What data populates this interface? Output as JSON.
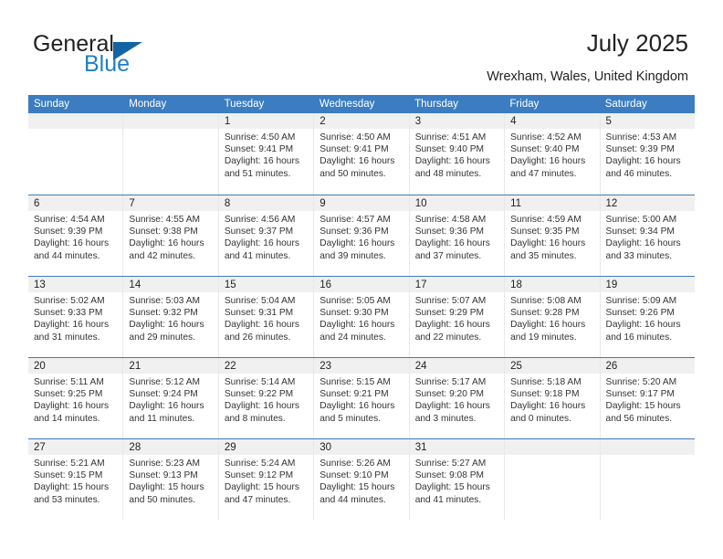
{
  "brand": {
    "name_part1": "General",
    "name_part2": "Blue",
    "accent_color": "#1f7fc4",
    "triangle_color": "#1464a5"
  },
  "header": {
    "title": "July 2025",
    "subtitle": "Wrexham, Wales, United Kingdom"
  },
  "calendar": {
    "header_color": "#3b7dc0",
    "weekdays": [
      "Sunday",
      "Monday",
      "Tuesday",
      "Wednesday",
      "Thursday",
      "Friday",
      "Saturday"
    ],
    "weeks": [
      [
        {
          "day": "",
          "sunrise": "",
          "sunset": "",
          "daylight_line1": "",
          "daylight_line2": "",
          "empty": true
        },
        {
          "day": "",
          "sunrise": "",
          "sunset": "",
          "daylight_line1": "",
          "daylight_line2": "",
          "empty": true
        },
        {
          "day": "1",
          "sunrise": "Sunrise: 4:50 AM",
          "sunset": "Sunset: 9:41 PM",
          "daylight_line1": "Daylight: 16 hours",
          "daylight_line2": "and 51 minutes."
        },
        {
          "day": "2",
          "sunrise": "Sunrise: 4:50 AM",
          "sunset": "Sunset: 9:41 PM",
          "daylight_line1": "Daylight: 16 hours",
          "daylight_line2": "and 50 minutes."
        },
        {
          "day": "3",
          "sunrise": "Sunrise: 4:51 AM",
          "sunset": "Sunset: 9:40 PM",
          "daylight_line1": "Daylight: 16 hours",
          "daylight_line2": "and 48 minutes."
        },
        {
          "day": "4",
          "sunrise": "Sunrise: 4:52 AM",
          "sunset": "Sunset: 9:40 PM",
          "daylight_line1": "Daylight: 16 hours",
          "daylight_line2": "and 47 minutes."
        },
        {
          "day": "5",
          "sunrise": "Sunrise: 4:53 AM",
          "sunset": "Sunset: 9:39 PM",
          "daylight_line1": "Daylight: 16 hours",
          "daylight_line2": "and 46 minutes."
        }
      ],
      [
        {
          "day": "6",
          "sunrise": "Sunrise: 4:54 AM",
          "sunset": "Sunset: 9:39 PM",
          "daylight_line1": "Daylight: 16 hours",
          "daylight_line2": "and 44 minutes."
        },
        {
          "day": "7",
          "sunrise": "Sunrise: 4:55 AM",
          "sunset": "Sunset: 9:38 PM",
          "daylight_line1": "Daylight: 16 hours",
          "daylight_line2": "and 42 minutes."
        },
        {
          "day": "8",
          "sunrise": "Sunrise: 4:56 AM",
          "sunset": "Sunset: 9:37 PM",
          "daylight_line1": "Daylight: 16 hours",
          "daylight_line2": "and 41 minutes."
        },
        {
          "day": "9",
          "sunrise": "Sunrise: 4:57 AM",
          "sunset": "Sunset: 9:36 PM",
          "daylight_line1": "Daylight: 16 hours",
          "daylight_line2": "and 39 minutes."
        },
        {
          "day": "10",
          "sunrise": "Sunrise: 4:58 AM",
          "sunset": "Sunset: 9:36 PM",
          "daylight_line1": "Daylight: 16 hours",
          "daylight_line2": "and 37 minutes."
        },
        {
          "day": "11",
          "sunrise": "Sunrise: 4:59 AM",
          "sunset": "Sunset: 9:35 PM",
          "daylight_line1": "Daylight: 16 hours",
          "daylight_line2": "and 35 minutes."
        },
        {
          "day": "12",
          "sunrise": "Sunrise: 5:00 AM",
          "sunset": "Sunset: 9:34 PM",
          "daylight_line1": "Daylight: 16 hours",
          "daylight_line2": "and 33 minutes."
        }
      ],
      [
        {
          "day": "13",
          "sunrise": "Sunrise: 5:02 AM",
          "sunset": "Sunset: 9:33 PM",
          "daylight_line1": "Daylight: 16 hours",
          "daylight_line2": "and 31 minutes."
        },
        {
          "day": "14",
          "sunrise": "Sunrise: 5:03 AM",
          "sunset": "Sunset: 9:32 PM",
          "daylight_line1": "Daylight: 16 hours",
          "daylight_line2": "and 29 minutes."
        },
        {
          "day": "15",
          "sunrise": "Sunrise: 5:04 AM",
          "sunset": "Sunset: 9:31 PM",
          "daylight_line1": "Daylight: 16 hours",
          "daylight_line2": "and 26 minutes."
        },
        {
          "day": "16",
          "sunrise": "Sunrise: 5:05 AM",
          "sunset": "Sunset: 9:30 PM",
          "daylight_line1": "Daylight: 16 hours",
          "daylight_line2": "and 24 minutes."
        },
        {
          "day": "17",
          "sunrise": "Sunrise: 5:07 AM",
          "sunset": "Sunset: 9:29 PM",
          "daylight_line1": "Daylight: 16 hours",
          "daylight_line2": "and 22 minutes."
        },
        {
          "day": "18",
          "sunrise": "Sunrise: 5:08 AM",
          "sunset": "Sunset: 9:28 PM",
          "daylight_line1": "Daylight: 16 hours",
          "daylight_line2": "and 19 minutes."
        },
        {
          "day": "19",
          "sunrise": "Sunrise: 5:09 AM",
          "sunset": "Sunset: 9:26 PM",
          "daylight_line1": "Daylight: 16 hours",
          "daylight_line2": "and 16 minutes."
        }
      ],
      [
        {
          "day": "20",
          "sunrise": "Sunrise: 5:11 AM",
          "sunset": "Sunset: 9:25 PM",
          "daylight_line1": "Daylight: 16 hours",
          "daylight_line2": "and 14 minutes."
        },
        {
          "day": "21",
          "sunrise": "Sunrise: 5:12 AM",
          "sunset": "Sunset: 9:24 PM",
          "daylight_line1": "Daylight: 16 hours",
          "daylight_line2": "and 11 minutes."
        },
        {
          "day": "22",
          "sunrise": "Sunrise: 5:14 AM",
          "sunset": "Sunset: 9:22 PM",
          "daylight_line1": "Daylight: 16 hours",
          "daylight_line2": "and 8 minutes."
        },
        {
          "day": "23",
          "sunrise": "Sunrise: 5:15 AM",
          "sunset": "Sunset: 9:21 PM",
          "daylight_line1": "Daylight: 16 hours",
          "daylight_line2": "and 5 minutes."
        },
        {
          "day": "24",
          "sunrise": "Sunrise: 5:17 AM",
          "sunset": "Sunset: 9:20 PM",
          "daylight_line1": "Daylight: 16 hours",
          "daylight_line2": "and 3 minutes."
        },
        {
          "day": "25",
          "sunrise": "Sunrise: 5:18 AM",
          "sunset": "Sunset: 9:18 PM",
          "daylight_line1": "Daylight: 16 hours",
          "daylight_line2": "and 0 minutes."
        },
        {
          "day": "26",
          "sunrise": "Sunrise: 5:20 AM",
          "sunset": "Sunset: 9:17 PM",
          "daylight_line1": "Daylight: 15 hours",
          "daylight_line2": "and 56 minutes."
        }
      ],
      [
        {
          "day": "27",
          "sunrise": "Sunrise: 5:21 AM",
          "sunset": "Sunset: 9:15 PM",
          "daylight_line1": "Daylight: 15 hours",
          "daylight_line2": "and 53 minutes."
        },
        {
          "day": "28",
          "sunrise": "Sunrise: 5:23 AM",
          "sunset": "Sunset: 9:13 PM",
          "daylight_line1": "Daylight: 15 hours",
          "daylight_line2": "and 50 minutes."
        },
        {
          "day": "29",
          "sunrise": "Sunrise: 5:24 AM",
          "sunset": "Sunset: 9:12 PM",
          "daylight_line1": "Daylight: 15 hours",
          "daylight_line2": "and 47 minutes."
        },
        {
          "day": "30",
          "sunrise": "Sunrise: 5:26 AM",
          "sunset": "Sunset: 9:10 PM",
          "daylight_line1": "Daylight: 15 hours",
          "daylight_line2": "and 44 minutes."
        },
        {
          "day": "31",
          "sunrise": "Sunrise: 5:27 AM",
          "sunset": "Sunset: 9:08 PM",
          "daylight_line1": "Daylight: 15 hours",
          "daylight_line2": "and 41 minutes."
        },
        {
          "day": "",
          "sunrise": "",
          "sunset": "",
          "daylight_line1": "",
          "daylight_line2": "",
          "empty": true
        },
        {
          "day": "",
          "sunrise": "",
          "sunset": "",
          "daylight_line1": "",
          "daylight_line2": "",
          "empty": true
        }
      ]
    ]
  }
}
